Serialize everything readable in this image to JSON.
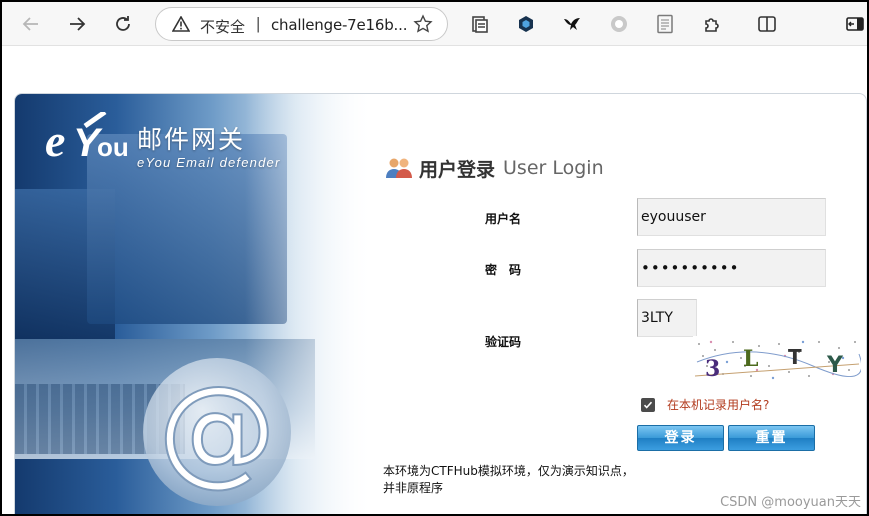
{
  "browser": {
    "security_label": "不安全",
    "separator": "|",
    "url": "challenge-7e16b...",
    "icons": [
      "back-icon",
      "forward-icon",
      "reload-icon",
      "warning-icon",
      "star-icon",
      "tab-collections-icon",
      "extension-shield-icon",
      "extension-bird-icon",
      "extension-circle-icon",
      "reading-mode-icon",
      "extensions-puzzle-icon",
      "split-screen-icon",
      "sidebar-icon"
    ]
  },
  "logo": {
    "mark": "eYou",
    "title": "邮件网关",
    "subtitle": "eYou Email defender"
  },
  "login": {
    "title_cn": "用户登录",
    "title_en": "User Login",
    "username_label": "用户名",
    "username_value": "eyouuser",
    "password_label": "密　码",
    "password_value": "••••••••••",
    "captcha_label": "验证码",
    "captcha_value": "3LTY",
    "captcha_image_text": [
      "3",
      "L",
      "T",
      "Y"
    ],
    "remember_label": "在本机记录用户名?",
    "remember_checked": true,
    "login_button": "登录",
    "reset_button": "重置",
    "notice": "本环境为CTFHub模拟环境，仅为演示知识点，并非原程序"
  },
  "watermark": "CSDN @mooyuan天天",
  "colors": {
    "button_blue": "#3a9ad8",
    "remember_text": "#b23b1e",
    "toolbar_bg": "#f7f7f7"
  }
}
